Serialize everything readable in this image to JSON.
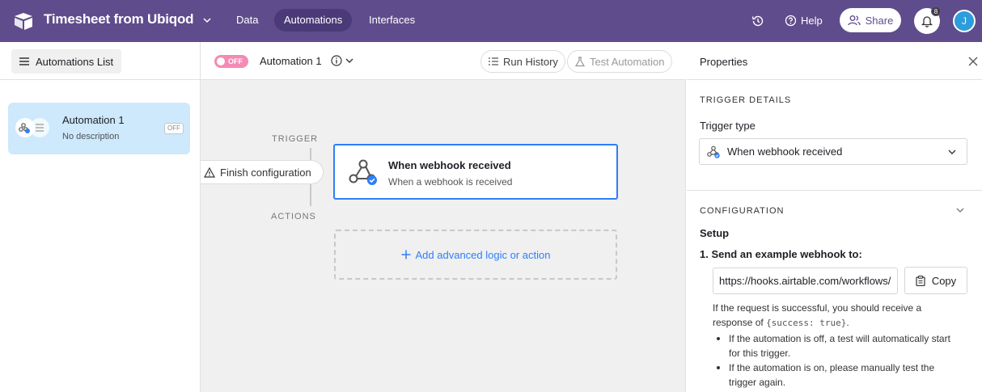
{
  "topbar": {
    "app_title": "Timesheet from Ubiqod",
    "tabs": [
      {
        "label": "Data"
      },
      {
        "label": "Automations",
        "active": true
      },
      {
        "label": "Interfaces"
      }
    ],
    "help_label": "Help",
    "share_label": "Share",
    "notification_count": "8",
    "avatar_initial": "J",
    "color": "#5f4c8c"
  },
  "sidebar": {
    "list_button": "Automations List",
    "automations": [
      {
        "name": "Automation 1",
        "description": "No description",
        "status": "OFF"
      }
    ]
  },
  "editor": {
    "toggle_label": "OFF",
    "automation_title": "Automation 1",
    "run_history": "Run History",
    "test_automation": "Test Automation",
    "trigger_label": "TRIGGER",
    "actions_label": "ACTIONS",
    "finish_config": "Finish configuration",
    "trigger_card": {
      "title": "When webhook received",
      "subtitle": "When a webhook is received"
    },
    "add_action": "Add advanced logic or action",
    "accent": "#2d7ff9"
  },
  "properties": {
    "title": "Properties",
    "trigger_details_label": "TRIGGER DETAILS",
    "trigger_type_label": "Trigger type",
    "trigger_type_value": "When webhook received",
    "configuration_label": "CONFIGURATION",
    "setup_label": "Setup",
    "step1_label": "1. Send an example webhook to:",
    "webhook_url": "https://hooks.airtable.com/workflows/",
    "copy_label": "Copy",
    "success_text_1": "If the request is successful, you should receive a response of",
    "success_code": "{success: true}",
    "success_text_2": ".",
    "bullets": [
      "If the automation is off, a test will automatically start for this trigger.",
      "If the automation is on, please manually test the trigger again."
    ]
  }
}
